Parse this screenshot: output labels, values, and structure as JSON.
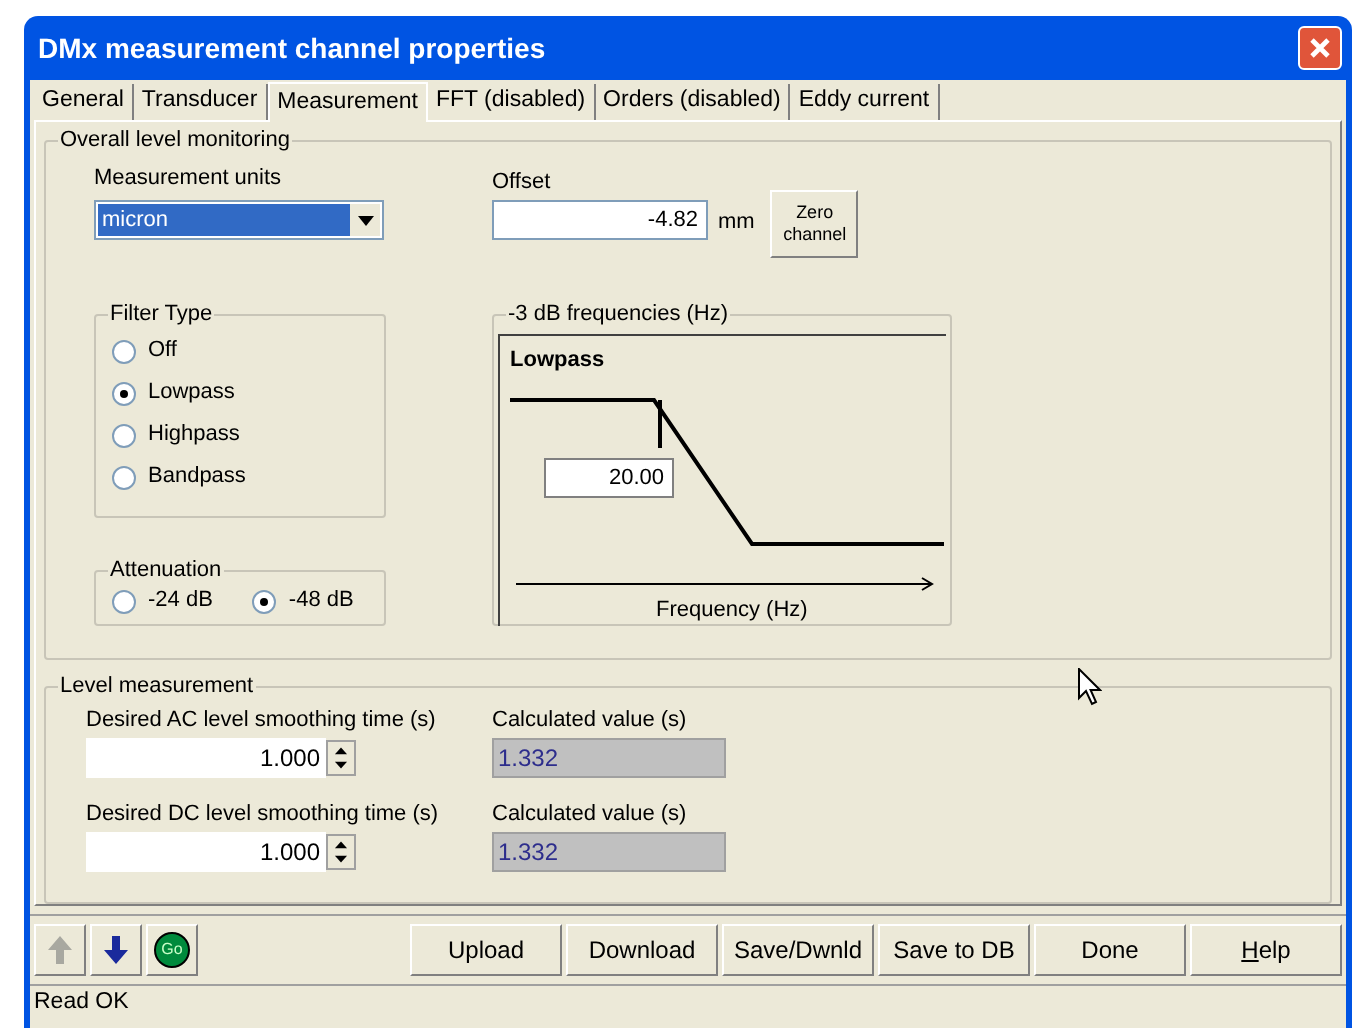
{
  "window": {
    "title": "DMx measurement channel properties"
  },
  "tabs": [
    {
      "label": "General",
      "selected": false
    },
    {
      "label": "Transducer",
      "selected": false
    },
    {
      "label": "Measurement",
      "selected": true
    },
    {
      "label": "FFT (disabled)",
      "selected": false
    },
    {
      "label": "Orders (disabled)",
      "selected": false
    },
    {
      "label": "Eddy current",
      "selected": false
    }
  ],
  "overall": {
    "title": "Overall level monitoring",
    "units": {
      "label": "Measurement units",
      "value": "micron"
    },
    "offset": {
      "label": "Offset",
      "value": "-4.82",
      "unit": "mm",
      "button": "Zero channel"
    },
    "filter_type": {
      "title": "Filter Type",
      "options": [
        {
          "label": "Off",
          "selected": false
        },
        {
          "label": "Lowpass",
          "selected": true
        },
        {
          "label": "Highpass",
          "selected": false
        },
        {
          "label": "Bandpass",
          "selected": false
        }
      ]
    },
    "attenuation": {
      "title": "Attenuation",
      "options": [
        {
          "label": "-24 dB",
          "selected": false
        },
        {
          "label": "-48 dB",
          "selected": true
        }
      ]
    },
    "frequencies": {
      "title": "-3 dB frequencies (Hz)",
      "filter": "Lowpass",
      "value": "20.00",
      "axis": "Frequency (Hz)"
    }
  },
  "level": {
    "title": "Level measurement",
    "rows": [
      {
        "label": "Desired AC level smoothing time (s)",
        "value": "1.000",
        "calc_label": "Calculated value (s)",
        "calc_value": "1.332"
      },
      {
        "label": "Desired DC level smoothing time (s)",
        "value": "1.000",
        "calc_label": "Calculated value (s)",
        "calc_value": "1.332"
      }
    ]
  },
  "toolbar": {
    "nav": [
      {
        "kind": "up",
        "disabled": true
      },
      {
        "kind": "down",
        "disabled": false
      },
      {
        "kind": "go",
        "label": "Go",
        "disabled": false
      }
    ],
    "buttons": [
      {
        "label": "Upload",
        "mnemonic": false
      },
      {
        "label": "Download",
        "mnemonic": false
      },
      {
        "label": "Save/Dwnld",
        "mnemonic": false
      },
      {
        "label": "Save to DB",
        "mnemonic": false
      },
      {
        "label": "Done",
        "mnemonic": false
      },
      {
        "label": "Help",
        "mnemonic": true
      }
    ]
  },
  "status_bar": "Read OK"
}
